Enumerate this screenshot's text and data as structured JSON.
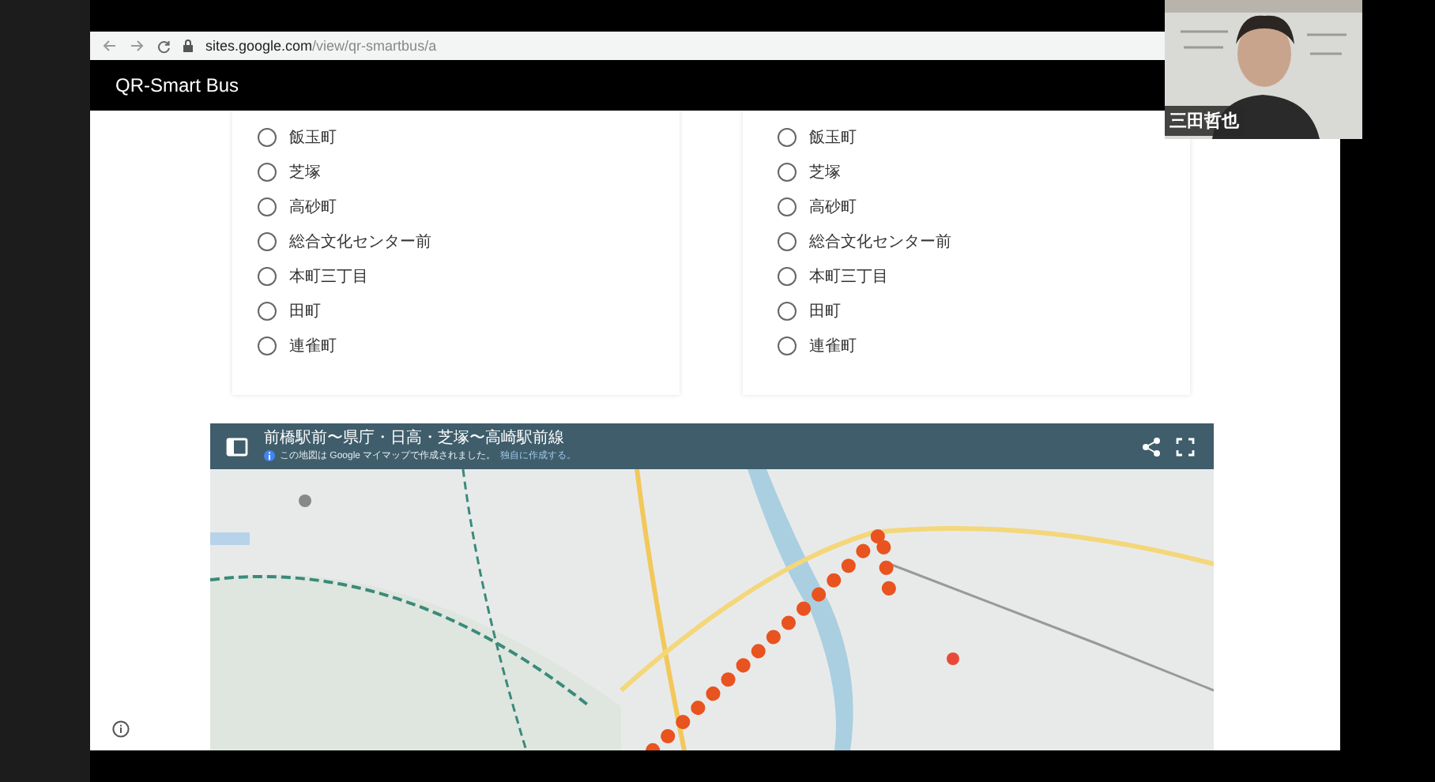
{
  "browser": {
    "url_host": "sites.google.com",
    "url_path": "/view/qr-smartbus/a"
  },
  "site": {
    "title": "QR-Smart Bus"
  },
  "choice_lists": [
    {
      "options": [
        {
          "label": "飯玉町",
          "selected": false
        },
        {
          "label": "芝塚",
          "selected": false
        },
        {
          "label": "高砂町",
          "selected": false
        },
        {
          "label": "総合文化センター前",
          "selected": false
        },
        {
          "label": "本町三丁目",
          "selected": false
        },
        {
          "label": "田町",
          "selected": false
        },
        {
          "label": "連雀町",
          "selected": false
        }
      ]
    },
    {
      "options": [
        {
          "label": "飯玉町",
          "selected": false
        },
        {
          "label": "芝塚",
          "selected": false
        },
        {
          "label": "高砂町",
          "selected": false
        },
        {
          "label": "総合文化センター前",
          "selected": false
        },
        {
          "label": "本町三丁目",
          "selected": false
        },
        {
          "label": "田町",
          "selected": false
        },
        {
          "label": "連雀町",
          "selected": false
        }
      ]
    }
  ],
  "map": {
    "title": "前橋駅前〜県庁・日高・芝塚〜高崎駅前線",
    "credit": "この地図は Google マイマップで作成されました。",
    "credit_link": "独自に作成する。",
    "kind": "picture"
  },
  "video": {
    "participant": "三田哲也",
    "kind": "picture"
  }
}
